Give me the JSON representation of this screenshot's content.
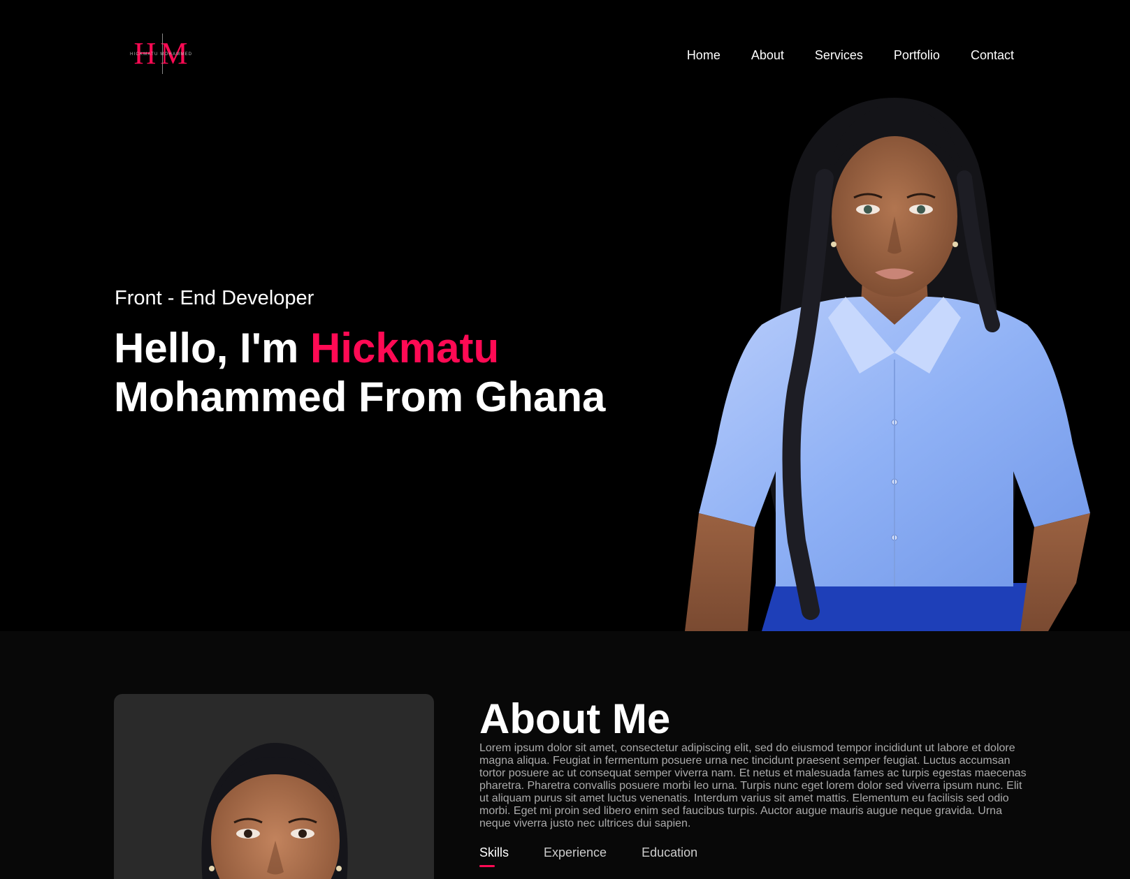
{
  "brand": {
    "logo_letters": "HM",
    "logo_subtext": "HICKMATU MOHAMMED",
    "accent_color": "#ff0a54"
  },
  "nav": {
    "items": [
      {
        "label": "Home"
      },
      {
        "label": "About"
      },
      {
        "label": "Services"
      },
      {
        "label": "Portfolio"
      },
      {
        "label": "Contact"
      }
    ]
  },
  "hero": {
    "subtitle": "Front - End Developer",
    "title_prefix": "Hello, I'm ",
    "title_name": "Hickmatu",
    "title_suffix": "Mohammed From Ghana",
    "image": "portrait-photo"
  },
  "about": {
    "heading": "About Me",
    "body": "Lorem ipsum dolor sit amet, consectetur adipiscing elit, sed do eiusmod tempor incididunt ut labore et dolore magna aliqua. Feugiat in fermentum posuere urna nec tincidunt praesent semper feugiat. Luctus accumsan tortor posuere ac ut consequat semper viverra nam. Et netus et malesuada fames ac turpis egestas maecenas pharetra. Pharetra convallis posuere morbi leo urna. Turpis nunc eget lorem dolor sed viverra ipsum nunc. Elit ut aliquam purus sit amet luctus venenatis. Interdum varius sit amet mattis. Elementum eu facilisis sed odio morbi. Eget mi proin sed libero enim sed faucibus turpis. Auctor augue mauris augue neque gravida. Urna neque viverra justo nec ultrices dui sapien.",
    "image": "profile-photo",
    "tabs": [
      {
        "label": "Skills",
        "active": true
      },
      {
        "label": "Experience",
        "active": false
      },
      {
        "label": "Education",
        "active": false
      }
    ]
  }
}
